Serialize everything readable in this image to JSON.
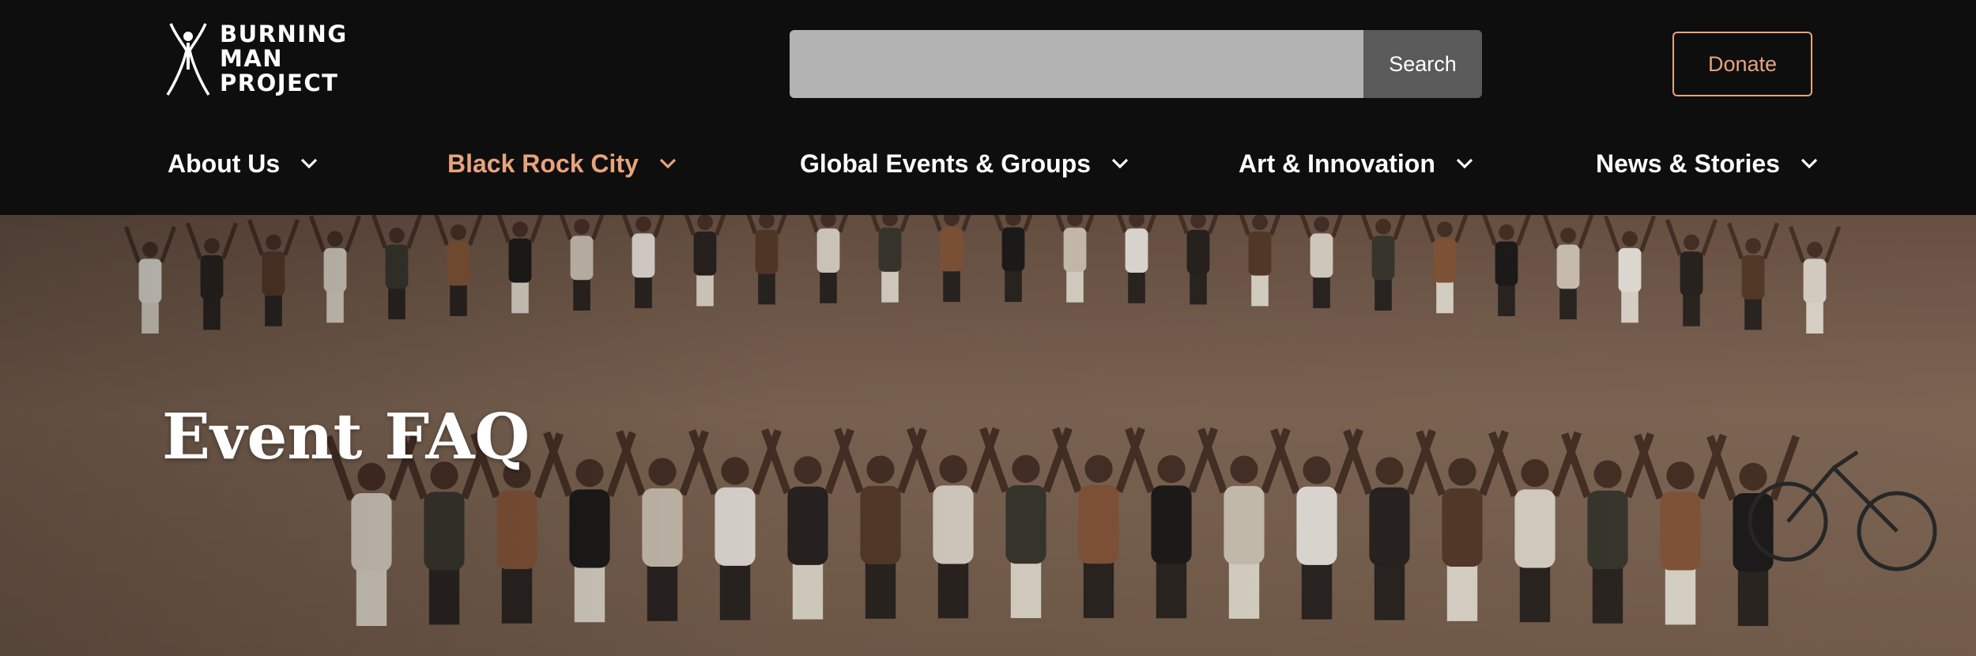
{
  "header": {
    "logo": {
      "name": "burning-man-logo",
      "line1": "BURNING",
      "line2": "MAN",
      "line3": "PROJECT"
    },
    "search": {
      "value": "",
      "placeholder": "",
      "button_label": "Search"
    },
    "donate_label": "Donate"
  },
  "nav": {
    "items": [
      {
        "label": "About Us",
        "active": false,
        "icon": "chevron-down-icon"
      },
      {
        "label": "Black Rock City",
        "active": true,
        "icon": "chevron-down-icon"
      },
      {
        "label": "Global Events & Groups",
        "active": false,
        "icon": "chevron-down-icon"
      },
      {
        "label": "Art & Innovation",
        "active": false,
        "icon": "chevron-down-icon"
      },
      {
        "label": "News & Stories",
        "active": false,
        "icon": "chevron-down-icon"
      }
    ]
  },
  "hero": {
    "title": "Event FAQ",
    "image": "people-holding-hands-in-circle-on-playa"
  },
  "colors": {
    "background": "#0e0e0e",
    "accent": "#e8a37c",
    "search_field": "#b3b3b3",
    "search_button": "#5a5a5a"
  }
}
